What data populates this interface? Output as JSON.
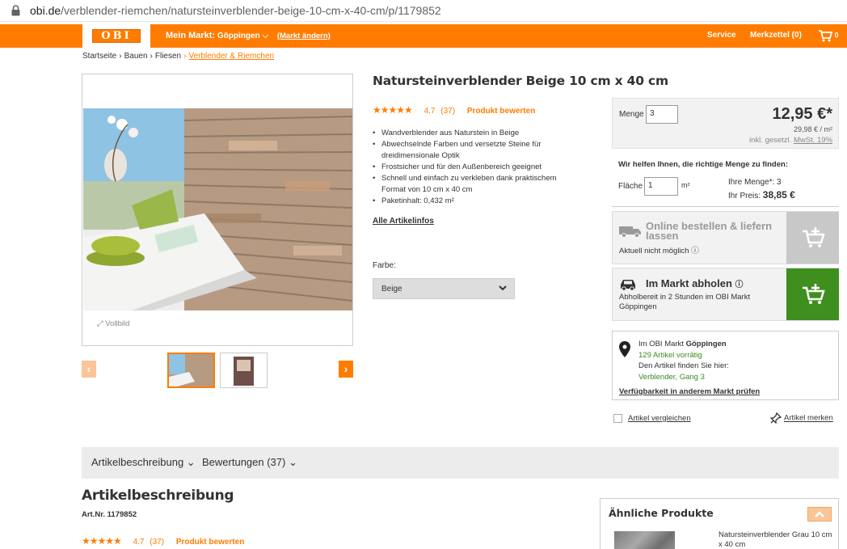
{
  "browser": {
    "url_domain": "obi.de",
    "url_path": "/verblender-riemchen/natursteinverblender-beige-10-cm-x-40-cm/p/1179852"
  },
  "header": {
    "logo_text": "OBI",
    "my_market_label": "Mein Markt:",
    "my_market_value": "Göppingen",
    "change_market": "(Markt ändern)",
    "service": "Service",
    "merkzettel": "Merkzettel (0)",
    "cart_count": "0"
  },
  "breadcrumb": [
    "Startseite",
    "Bauen",
    "Fliesen",
    "Verblender & Riemchen"
  ],
  "gallery": {
    "vollbild": "Vollbild",
    "prev": "‹",
    "next": "›"
  },
  "product": {
    "title": "Natursteinverblender Beige 10 cm x 40 cm",
    "stars": "★★★★★",
    "rating": "4.7",
    "rating_count": "(37)",
    "rate_link": "Produkt bewerten",
    "bullets": [
      "Wandverblender aus Naturstein in Beige",
      "Abwechselnde Farben und versetzte Steine für dreidimensionale Optik",
      "Frostsicher und für den Außenbereich geeignet",
      "Schnell und einfach zu verkleben dank praktischem Format von 10 cm x 40 cm",
      "Paketinhalt: 0,432 m²"
    ],
    "all_info": "Alle Artikelinfos",
    "color_label": "Farbe:",
    "color_value": "Beige"
  },
  "buy": {
    "qty_label": "Menge",
    "qty_value": "3",
    "price": "12,95 €*",
    "unit_price": "29,98 € / m²",
    "vat_prefix": "inkl. gesetzl.",
    "vat_link": "MwSt. 19%",
    "help_title": "Wir helfen Ihnen, die richtige Menge zu finden:",
    "area_label": "Fläche",
    "area_value": "1",
    "area_unit": "m²",
    "your_qty_label": "Ihre Menge*:",
    "your_qty_value": "3",
    "your_price_label": "Ihr Preis:",
    "your_price_value": "38,85 €",
    "online_title": "Online bestellen & liefern lassen",
    "online_sub": "Aktuell nicht möglich",
    "pickup_title": "Im Markt abholen",
    "pickup_sub": "Abholbereit in 2 Stunden im OBI Markt Göppingen"
  },
  "market": {
    "line1_prefix": "Im OBI Markt",
    "line1_market": "Göppingen",
    "stock": "129 Artikel vorrätig",
    "find_here": "Den Artikel finden Sie hier:",
    "location": "Verblender, Gang 3",
    "other_market": "Verfügbarkeit in anderem Markt prüfen"
  },
  "actions": {
    "compare": "Artikel vergleichen",
    "remember": "Artikel merken"
  },
  "tabs": [
    "Artikelbeschreibung",
    "Bewertungen (37)"
  ],
  "description": {
    "heading": "Artikelbeschreibung",
    "artnr": "Art.Nr. 1179852",
    "stars": "★★★★★",
    "rating": "4.7",
    "rating_count": "(37)",
    "rate_link": "Produkt bewerten"
  },
  "similar": {
    "heading": "Ähnliche Produkte",
    "item_name": "Natursteinverblender Grau 10 cm x 40 cm"
  },
  "colors": {
    "brand_orange": "#ff7c00",
    "pickup_green": "#3f8f1e",
    "stock_green": "#3a8a1f"
  }
}
